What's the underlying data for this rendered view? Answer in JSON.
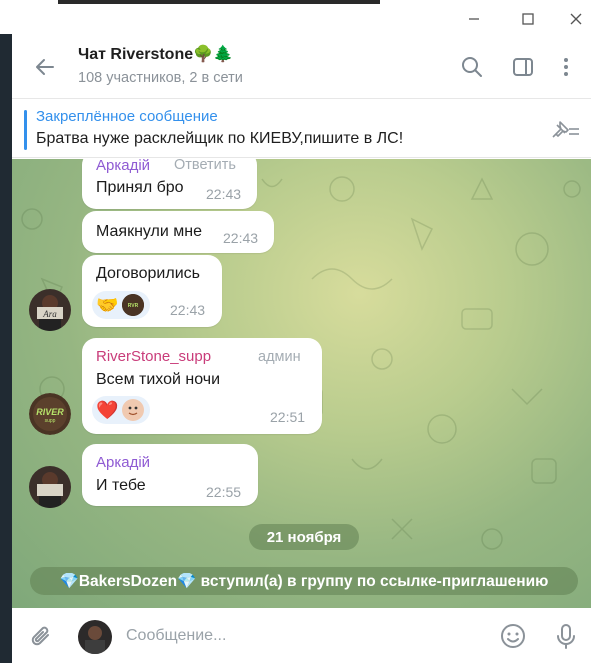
{
  "window": {
    "minimize_icon": "minimize-icon",
    "maximize_icon": "maximize-icon",
    "close_icon": "close-icon"
  },
  "header": {
    "title": "Чат Riverstone🌳🌲",
    "subtitle": "108 участников, 2 в сети",
    "icons": [
      "back-arrow-icon",
      "search-icon",
      "sidebar-toggle-icon",
      "more-vertical-icon"
    ]
  },
  "pinned": {
    "title": "Закреплённое сообщение",
    "text": "Братва нуже расклейщик по КИЕВУ,пишите в ЛС!",
    "icon": "unpin-icon"
  },
  "messages": [
    {
      "sender": "Аркадій",
      "reply_label": "Ответить",
      "text": "Принял бро",
      "time": "22:43"
    },
    {
      "text": "Маякнули мне",
      "time": "22:43"
    },
    {
      "text": "Договорились",
      "time": "22:43",
      "reactions": [
        "🤝"
      ]
    },
    {
      "sender": "RiverStone_supp",
      "role": "админ",
      "text": "Всем тихой ночи",
      "time": "22:51",
      "reactions": [
        "❤️"
      ]
    },
    {
      "sender": "Аркадій",
      "text": "И тебе",
      "time": "22:55"
    }
  ],
  "date_separator": "21 ноября",
  "service_message": "💎BakersDozen💎 вступил(а) в группу по ссылке-приглашению",
  "avatars": {
    "arkadiy_label": "Ara",
    "riverstone_label": "RIVER"
  },
  "composer": {
    "placeholder": "Сообщение...",
    "icons": [
      "paperclip-icon",
      "emoji-icon",
      "microphone-icon"
    ]
  },
  "colors": {
    "accent": "#3390ec",
    "sender_arkadiy": "#8f5bd3",
    "sender_riverstone": "#c93c7a"
  }
}
